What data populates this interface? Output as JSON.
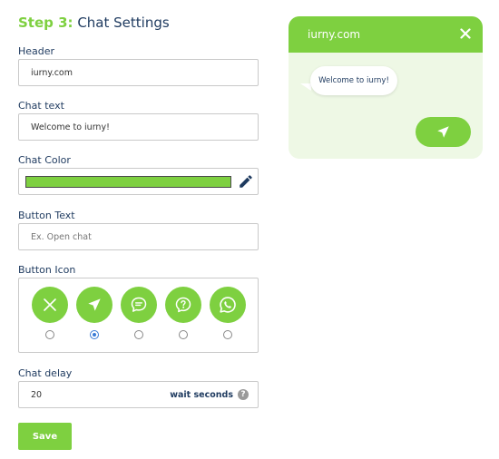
{
  "step": {
    "number": "Step 3:",
    "title": "Chat Settings"
  },
  "header_field": {
    "label": "Header",
    "value": "iurny.com"
  },
  "chat_text_field": {
    "label": "Chat text",
    "value": "Welcome to iurny!"
  },
  "chat_color": {
    "label": "Chat Color",
    "value": "#7ed040"
  },
  "button_text_field": {
    "label": "Button Text",
    "value": "",
    "placeholder": "Ex. Open chat"
  },
  "button_icon": {
    "label": "Button Icon",
    "options": [
      {
        "icon": "close-x-icon",
        "selected": false
      },
      {
        "icon": "send-arrow-icon",
        "selected": true
      },
      {
        "icon": "chat-bubble-icon",
        "selected": false
      },
      {
        "icon": "question-bubble-icon",
        "selected": false
      },
      {
        "icon": "whatsapp-icon",
        "selected": false
      }
    ]
  },
  "chat_delay": {
    "label": "Chat delay",
    "value": "20",
    "suffix": "wait seconds",
    "help": "?"
  },
  "save_label": "Save",
  "preview": {
    "title": "iurny.com",
    "message": "Welcome to iurny!"
  },
  "colors": {
    "accent": "#7ed040",
    "text": "#1e3a5f",
    "preview_bg": "#eef8e5"
  }
}
